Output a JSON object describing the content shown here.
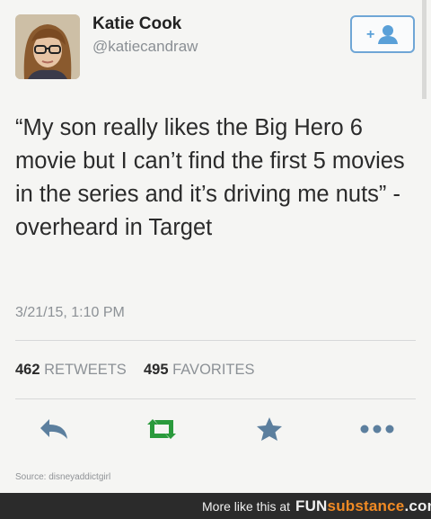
{
  "user": {
    "name": "Katie Cook",
    "handle": "@katiecandraw"
  },
  "tweet": {
    "text": "“My son really likes the Big Hero 6 movie but I can’t find the first 5 movies in the series and it’s driving me nuts” -overheard in Target",
    "timestamp": "3/21/15, 1:10 PM"
  },
  "stats": {
    "retweets_count": "462",
    "retweets_label": "RETWEETS",
    "favorites_count": "495",
    "favorites_label": "FAVORITES"
  },
  "actions": {
    "icons": [
      "reply-icon",
      "retweet-icon",
      "favorite-icon",
      "more-icon"
    ]
  },
  "follow_button": {
    "label": "+"
  },
  "source": "Source: disneyaddictgirl",
  "footer": {
    "more_text": "More like this at",
    "brand_part1": "FUN",
    "brand_part2": "substance",
    "brand_part3": ".com"
  },
  "colors": {
    "accent": "#5aa0d8",
    "retweet_green": "#2a9a3c",
    "icon_blue_gray": "#5c7f9e"
  }
}
